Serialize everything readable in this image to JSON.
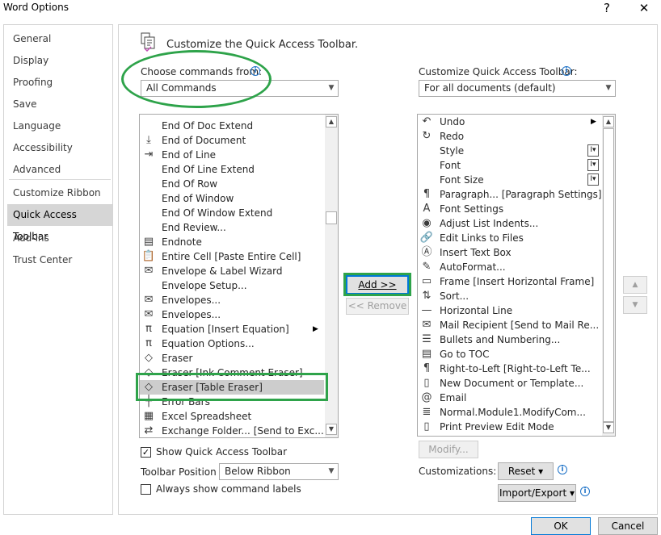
{
  "window": {
    "title": "Word Options",
    "help": "?",
    "close": "✕"
  },
  "nav": {
    "items": [
      {
        "label": "General"
      },
      {
        "label": "Display"
      },
      {
        "label": "Proofing"
      },
      {
        "label": "Save"
      },
      {
        "label": "Language"
      },
      {
        "label": "Accessibility"
      },
      {
        "label": "Advanced"
      },
      {
        "label": "Customize Ribbon"
      },
      {
        "label": "Quick Access Toolbar"
      },
      {
        "label": "Add-ins"
      },
      {
        "label": "Trust Center"
      }
    ],
    "active": "Quick Access Toolbar"
  },
  "main": {
    "heading": "Customize the Quick Access Toolbar.",
    "choose_label": "Choose commands from:",
    "choose_value": "All Commands",
    "customize_label": "Customize Quick Access Toolbar:",
    "customize_value": "For all documents (default)",
    "commands": [
      {
        "label": "End Of Doc Extend",
        "icon": ""
      },
      {
        "label": "End of Document",
        "icon": "end-of-document-icon",
        "glyph": "⤓"
      },
      {
        "label": "End of Line",
        "icon": "end-of-line-icon",
        "glyph": "⇥"
      },
      {
        "label": "End Of Line Extend",
        "icon": ""
      },
      {
        "label": "End Of Row",
        "icon": ""
      },
      {
        "label": "End of Window",
        "icon": ""
      },
      {
        "label": "End Of Window Extend",
        "icon": ""
      },
      {
        "label": "End Review...",
        "icon": ""
      },
      {
        "label": "Endnote",
        "icon": "endnote-icon",
        "glyph": "▤"
      },
      {
        "label": "Entire Cell [Paste Entire Cell]",
        "icon": "paste-icon",
        "glyph": "📋"
      },
      {
        "label": "Envelope & Label Wizard",
        "icon": "envelope-icon",
        "glyph": "✉"
      },
      {
        "label": "Envelope Setup...",
        "icon": ""
      },
      {
        "label": "Envelopes...",
        "icon": "envelope-icon",
        "glyph": "✉"
      },
      {
        "label": "Envelopes...",
        "icon": "envelope-icon",
        "glyph": "✉"
      },
      {
        "label": "Equation [Insert Equation]",
        "icon": "equation-icon",
        "glyph": "π",
        "submenu": true
      },
      {
        "label": "Equation Options...",
        "icon": "equation-icon",
        "glyph": "π"
      },
      {
        "label": "Eraser",
        "icon": "eraser-icon",
        "glyph": "◇"
      },
      {
        "label": "Eraser [Ink Comment Eraser]",
        "icon": "eraser-icon",
        "glyph": "◇"
      },
      {
        "label": "Eraser [Table Eraser]",
        "icon": "eraser-icon",
        "glyph": "◇"
      },
      {
        "label": "Error Bars",
        "icon": "error-bars-icon",
        "glyph": "┼"
      },
      {
        "label": "Excel Spreadsheet",
        "icon": "excel-icon",
        "glyph": "▦"
      },
      {
        "label": "Exchange Folder... [Send to Exc...",
        "icon": "exchange-icon",
        "glyph": "⇄"
      }
    ],
    "selected_command": "Eraser [Table Eraser]",
    "add_button": "Add >>",
    "remove_button": "<< Remove",
    "toolbar_items": [
      {
        "label": "Undo",
        "icon": "undo-icon",
        "glyph": "↶",
        "submenu": true
      },
      {
        "label": "Redo",
        "icon": "redo-icon",
        "glyph": "↻"
      },
      {
        "label": "Style",
        "icon": "",
        "style_box": true
      },
      {
        "label": "Font",
        "icon": "",
        "style_box": true
      },
      {
        "label": "Font Size",
        "icon": "",
        "style_box": true
      },
      {
        "label": "Paragraph... [Paragraph Settings]",
        "icon": "paragraph-icon",
        "glyph": "¶"
      },
      {
        "label": "Font Settings",
        "icon": "font-settings-icon",
        "glyph": "A"
      },
      {
        "label": "Adjust List Indents...",
        "icon": "list-indent-icon",
        "glyph": "◉"
      },
      {
        "label": "Edit Links to Files",
        "icon": "links-icon",
        "glyph": "🔗"
      },
      {
        "label": "Insert Text Box",
        "icon": "text-box-icon",
        "glyph": "Ⓐ"
      },
      {
        "label": "AutoFormat...",
        "icon": "autoformat-icon",
        "glyph": "✎"
      },
      {
        "label": "Frame [Insert Horizontal Frame]",
        "icon": "frame-icon",
        "glyph": "▭"
      },
      {
        "label": "Sort...",
        "icon": "sort-icon",
        "glyph": "⇅"
      },
      {
        "label": "Horizontal Line",
        "icon": "horizontal-line-icon",
        "glyph": "—"
      },
      {
        "label": "Mail Recipient [Send to Mail Re...",
        "icon": "mail-icon",
        "glyph": "✉"
      },
      {
        "label": "Bullets and Numbering...",
        "icon": "bullets-icon",
        "glyph": "☰"
      },
      {
        "label": "Go to TOC",
        "icon": "toc-icon",
        "glyph": "▤"
      },
      {
        "label": "Right-to-Left [Right-to-Left Te...",
        "icon": "rtl-icon",
        "glyph": "¶"
      },
      {
        "label": "New Document or Template...",
        "icon": "new-document-icon",
        "glyph": "▯"
      },
      {
        "label": "Email",
        "icon": "email-icon",
        "glyph": "@"
      },
      {
        "label": "Normal.Module1.ModifyCom...",
        "icon": "macro-icon",
        "glyph": "≣"
      },
      {
        "label": "Print Preview Edit Mode",
        "icon": "print-preview-icon",
        "glyph": "▯"
      }
    ],
    "modify_button": "Modify...",
    "show_toolbar_label": "Show Quick Access Toolbar",
    "show_toolbar_checked": true,
    "position_label": "Toolbar Position",
    "position_value": "Below Ribbon",
    "always_show_label": "Always show command labels",
    "always_show_checked": false,
    "customizations_label": "Customizations:",
    "reset_button": "Reset ▾",
    "import_export_button": "Import/Export ▾"
  },
  "footer": {
    "ok": "OK",
    "cancel": "Cancel"
  },
  "colors": {
    "highlight": "#2ea34a",
    "accent_info": "#1f73c8"
  }
}
